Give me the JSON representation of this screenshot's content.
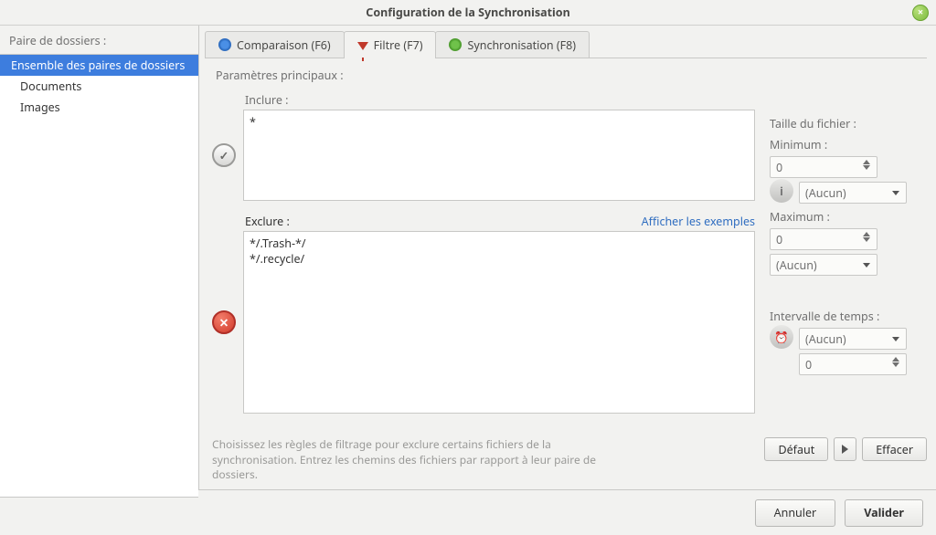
{
  "title": "Configuration de la Synchronisation",
  "sidebar": {
    "title": "Paire de dossiers :",
    "items": [
      {
        "label": "Ensemble des paires de dossiers",
        "selected": true
      },
      {
        "label": "Documents"
      },
      {
        "label": "Images"
      }
    ]
  },
  "tabs": {
    "compare": "Comparaison (F6)",
    "filter": "Filtre (F7)",
    "sync": "Synchronisation (F8)",
    "active": "filter"
  },
  "section_main": "Paramètres principaux :",
  "include": {
    "label": "Inclure :",
    "value": "*"
  },
  "exclude": {
    "label": "Exclure :",
    "examples_link": "Afficher les exemples",
    "value": "*/.Trash-*/\n*/.recycle/"
  },
  "filesize": {
    "title": "Taille du fichier :",
    "min_label": "Minimum :",
    "min_value": "0",
    "min_unit": "(Aucun)",
    "max_label": "Maximum :",
    "max_value": "0",
    "max_unit": "(Aucun)"
  },
  "timerange": {
    "title": "Intervalle de temps :",
    "unit": "(Aucun)",
    "value": "0"
  },
  "hint": "Choisissez les règles de filtrage pour exclure certains fichiers de la synchronisation. Entrez les chemins des fichiers par rapport à leur paire de dossiers.",
  "buttons": {
    "default": "Défaut",
    "clear": "Effacer",
    "cancel": "Annuler",
    "ok": "Valider"
  }
}
